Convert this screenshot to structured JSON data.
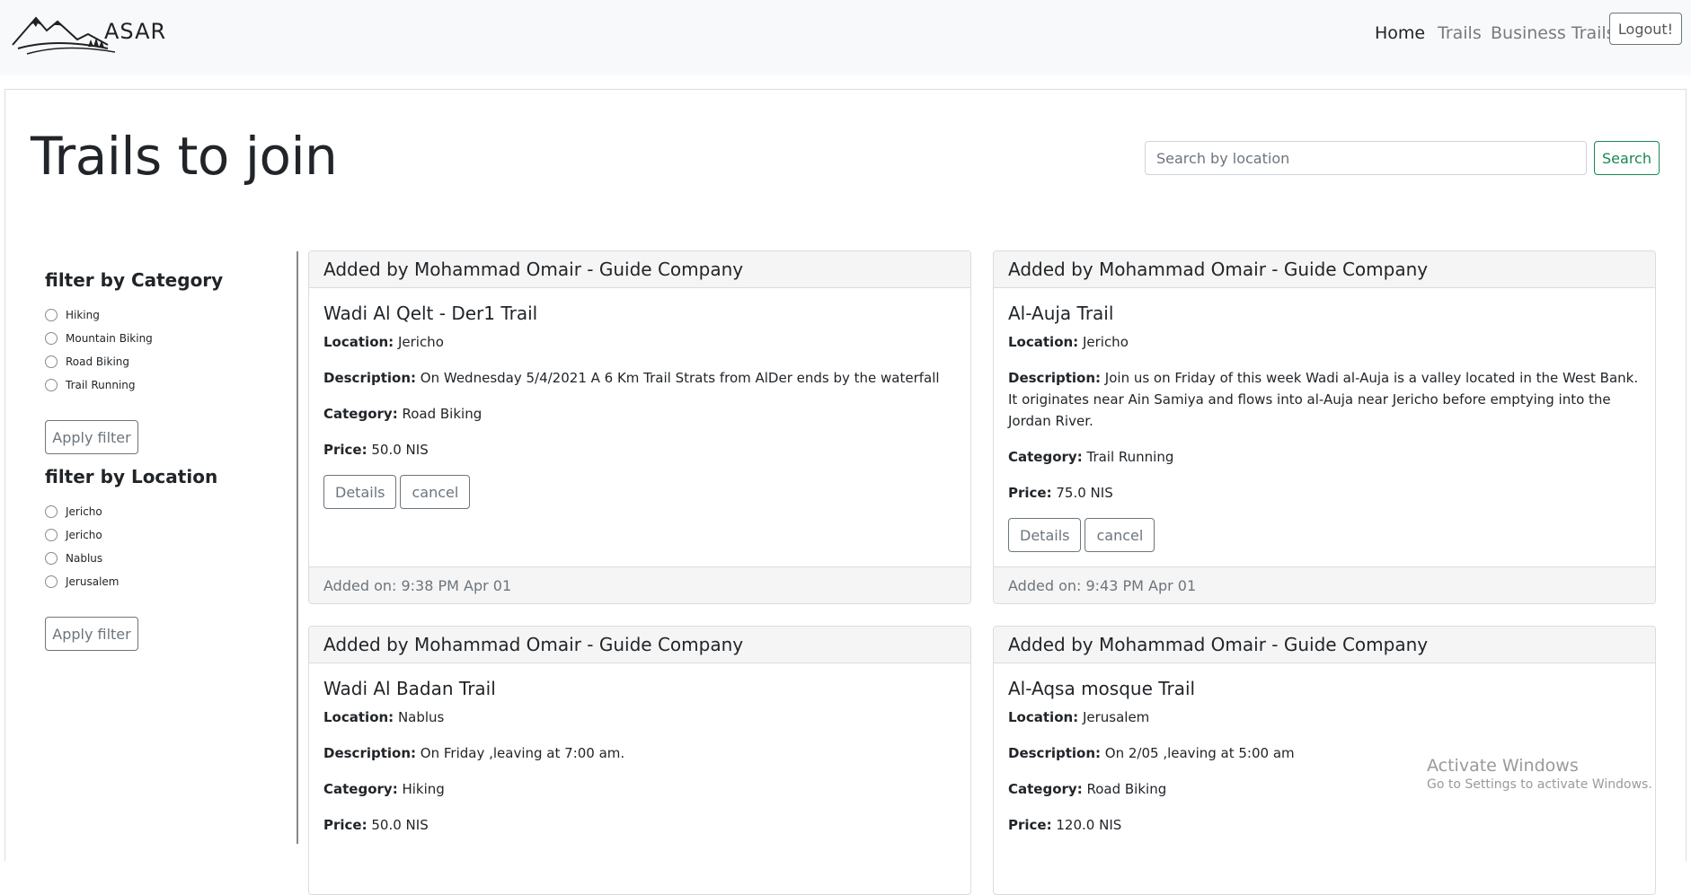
{
  "brand": {
    "name": "ASAR"
  },
  "nav": {
    "home": "Home",
    "trails": "Trails",
    "business_trails": "Business Trails",
    "logout": "Logout!"
  },
  "page": {
    "title": "Trails to join"
  },
  "search": {
    "placeholder": "Search by location",
    "button": "Search"
  },
  "filters": {
    "category": {
      "title": "filter by Category",
      "options": [
        "Hiking",
        "Mountain Biking",
        "Road Biking",
        "Trail Running"
      ],
      "apply": "Apply filter"
    },
    "location": {
      "title": "filter by Location",
      "options": [
        "Jericho",
        "Jericho",
        "Nablus",
        "Jerusalem"
      ],
      "apply": "Apply filter"
    }
  },
  "labels": {
    "location": "Location:",
    "description": "Description:",
    "category": "Category:",
    "price": "Price:"
  },
  "cards": [
    {
      "header": "Added by Mohammad Omair - Guide Company",
      "title": "Wadi Al Qelt - Der1 Trail",
      "location": "Jericho",
      "description": "On Wednesday 5/4/2021 A 6 Km Trail Strats from AlDer ends by the waterfall",
      "category": "Road Biking",
      "price": "50.0 NIS",
      "details": "Details",
      "cancel": "cancel",
      "footer": "Added on: 9:38 PM Apr 01"
    },
    {
      "header": "Added by Mohammad Omair - Guide Company",
      "title": "Al-Auja Trail",
      "location": "Jericho",
      "description": "Join us on Friday of this week Wadi al-Auja is a valley located in the West Bank. It originates near Ain Samiya and flows into al-Auja near Jericho before emptying into the Jordan River.",
      "category": "Trail Running",
      "price": "75.0 NIS",
      "details": "Details",
      "cancel": "cancel",
      "footer": "Added on: 9:43 PM Apr 01"
    },
    {
      "header": "Added by Mohammad Omair - Guide Company",
      "title": "Wadi Al Badan Trail",
      "location": "Nablus",
      "description": "On Friday ,leaving at 7:00 am.",
      "category": "Hiking",
      "price": "50.0 NIS"
    },
    {
      "header": "Added by Mohammad Omair - Guide Company",
      "title": "Al-Aqsa mosque Trail",
      "location": "Jerusalem",
      "description": "On 2/05 ,leaving at 5:00 am",
      "category": "Road Biking",
      "price": "120.0 NIS"
    }
  ],
  "watermark": {
    "title": "Activate Windows",
    "subtitle": "Go to Settings to activate Windows."
  }
}
